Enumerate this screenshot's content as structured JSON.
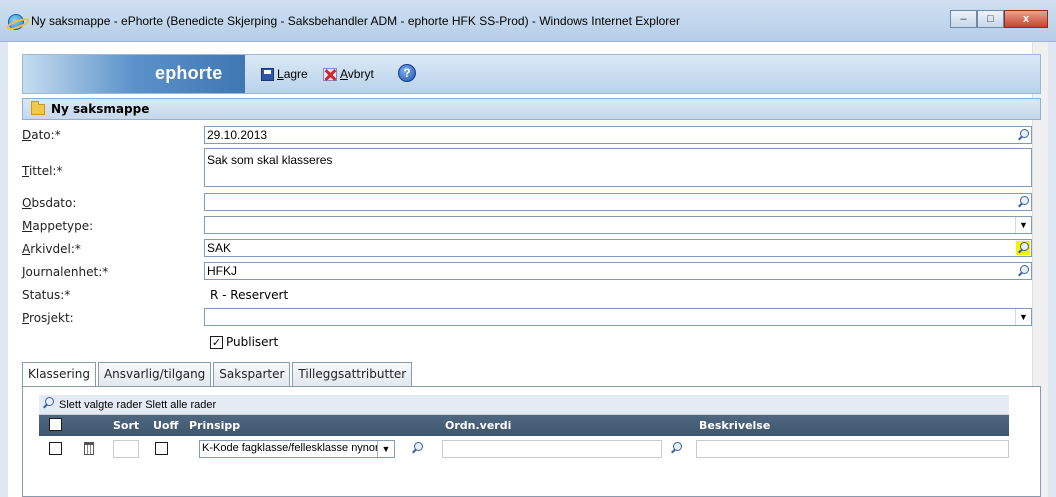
{
  "window": {
    "title": "Ny saksmappe - ePhorte (Benedicte Skjerping - Saksbehandler ADM - ephorte HFK SS-Prod) - Windows Internet Explorer",
    "minimize": "–",
    "maximize": "□",
    "close": "x"
  },
  "toolbar": {
    "logo_text": "ephorte",
    "save_label_mnemonic": "L",
    "save_label_rest": "agre",
    "cancel_label_mnemonic": "A",
    "cancel_label_rest": "vbryt",
    "help_glyph": "?"
  },
  "section": {
    "title": "Ny saksmappe"
  },
  "form": {
    "dato": {
      "label_mnemonic": "D",
      "label_rest": "ato:*",
      "value": "29.10.2013"
    },
    "tittel": {
      "label_mnemonic": "T",
      "label_rest": "ittel:*",
      "value": "Sak som skal klasseres"
    },
    "obsdato": {
      "label_mnemonic": "O",
      "label_rest": "bsdato:",
      "value": ""
    },
    "mappetype": {
      "label_mnemonic": "M",
      "label_rest": "appetype:",
      "value": ""
    },
    "arkivdel": {
      "label_mnemonic": "A",
      "label_rest": "rkivdel:*",
      "value": "SAK"
    },
    "journalenhet": {
      "label_mnemonic": "J",
      "label_rest": "ournalenhet:*",
      "value": "HFKJ"
    },
    "status": {
      "label": "Status:*",
      "value": "R - Reservert"
    },
    "prosjekt": {
      "label_mnemonic": "P",
      "label_rest": "rosjekt:",
      "value": ""
    },
    "publisert": {
      "label": "Publisert",
      "checked": "✓"
    }
  },
  "tabs": [
    {
      "label": "Klassering"
    },
    {
      "label": "Ansvarlig/tilgang"
    },
    {
      "label": "Saksparter"
    },
    {
      "label": "Tilleggsattributter"
    }
  ],
  "table": {
    "toolbar_text": "Slett valgte rader Slett alle rader",
    "headers": {
      "sort": "Sort",
      "uoff": "Uoff",
      "prinsipp": "Prinsipp",
      "ordnverdi": "Ordn.verdi",
      "beskrivelse": "Beskrivelse"
    },
    "row": {
      "prinsipp_value": "K-Kode fagklasse/fellesklasse nynorsk"
    }
  }
}
